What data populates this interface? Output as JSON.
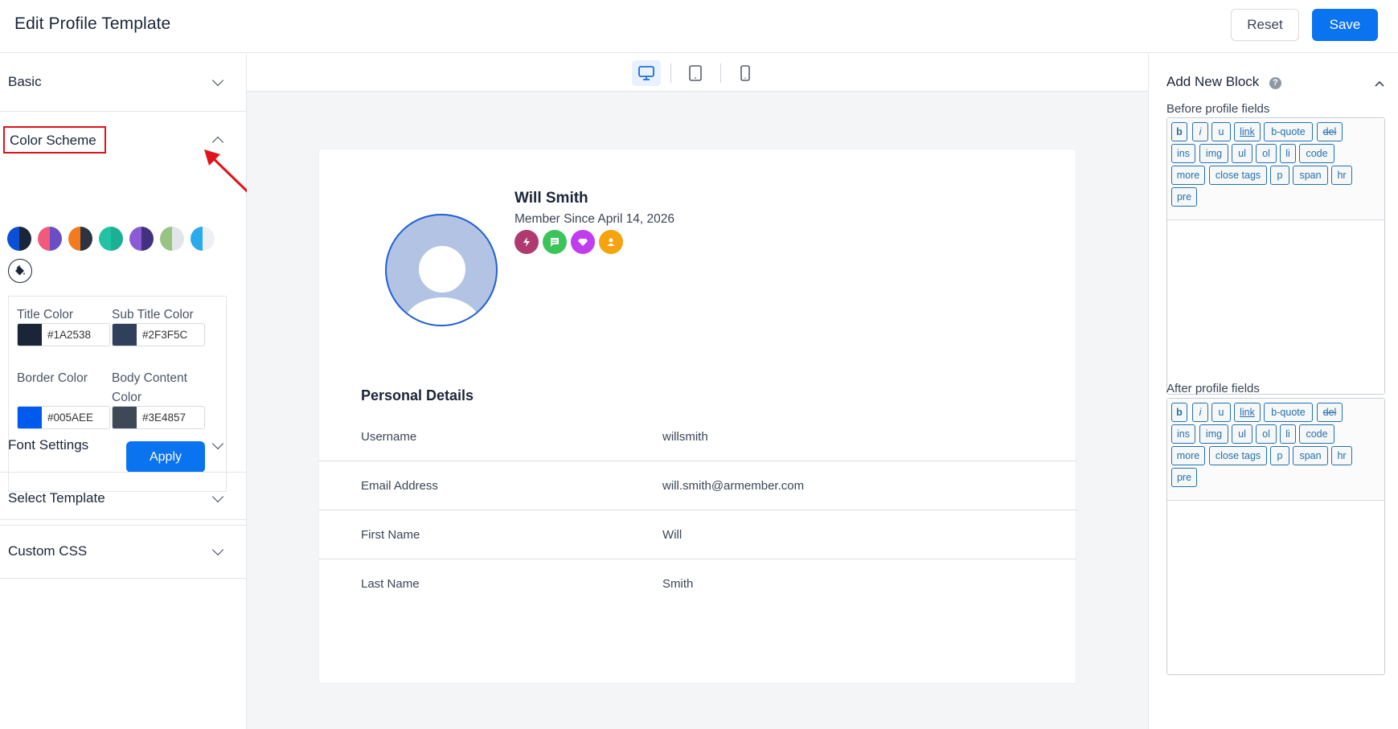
{
  "header": {
    "title": "Edit Profile Template",
    "reset_label": "Reset",
    "save_label": "Save"
  },
  "sidebar": {
    "sections": {
      "basic": "Basic",
      "color_scheme": "Color Scheme",
      "font_settings": "Font Settings",
      "select_template": "Select Template",
      "custom_css": "Custom CSS"
    },
    "swatches": [
      {
        "left": "#0a4fd6",
        "right": "#1a2538"
      },
      {
        "left": "#f25a7c",
        "right": "#6a4fc4"
      },
      {
        "left": "#f47a1f",
        "right": "#2d3340"
      },
      {
        "left": "#22c3a5",
        "right": "#1bb093"
      },
      {
        "left": "#8a5bd4",
        "right": "#43307e"
      },
      {
        "left": "#97c383",
        "right": "#e3e5e8"
      },
      {
        "left": "#2aa9ec",
        "right": "#eef0f3"
      }
    ],
    "colors": {
      "title_label": "Title Color",
      "title_value": "#1A2538",
      "subtitle_label": "Sub Title Color",
      "subtitle_value": "#2F3F5C",
      "border_label": "Border Color",
      "border_value": "#005AEE",
      "body_label_1": "Body Content",
      "body_label_2": "Color",
      "body_value": "#3E4857",
      "apply_label": "Apply"
    }
  },
  "preview": {
    "devices": [
      "desktop-icon",
      "tablet-icon",
      "mobile-icon"
    ],
    "active_device": "desktop",
    "name": "Will Smith",
    "member_since": "Member Since April 14, 2026",
    "badges": [
      {
        "icon": "bolt-icon",
        "color": "#b03a6e"
      },
      {
        "icon": "chat-icon",
        "color": "#3cc45a"
      },
      {
        "icon": "diamond-icon",
        "color": "#c23cf0"
      },
      {
        "icon": "user-icon",
        "color": "#f5a30f"
      }
    ],
    "section_title": "Personal Details",
    "rows": [
      {
        "label": "Username",
        "value": "willsmith"
      },
      {
        "label": "Email Address",
        "value": "will.smith@armember.com"
      },
      {
        "label": "First Name",
        "value": "Will"
      },
      {
        "label": "Last Name",
        "value": "Smith"
      }
    ]
  },
  "right_panel": {
    "title": "Add New Block",
    "help_icon": "?",
    "before_label": "Before profile fields",
    "after_label": "After profile fields",
    "quicktags": [
      "b",
      "i",
      "u",
      "link",
      "b-quote",
      "del",
      "ins",
      "img",
      "ul",
      "ol",
      "li",
      "code",
      "more",
      "close tags",
      "p",
      "span",
      "hr",
      "pre"
    ]
  }
}
